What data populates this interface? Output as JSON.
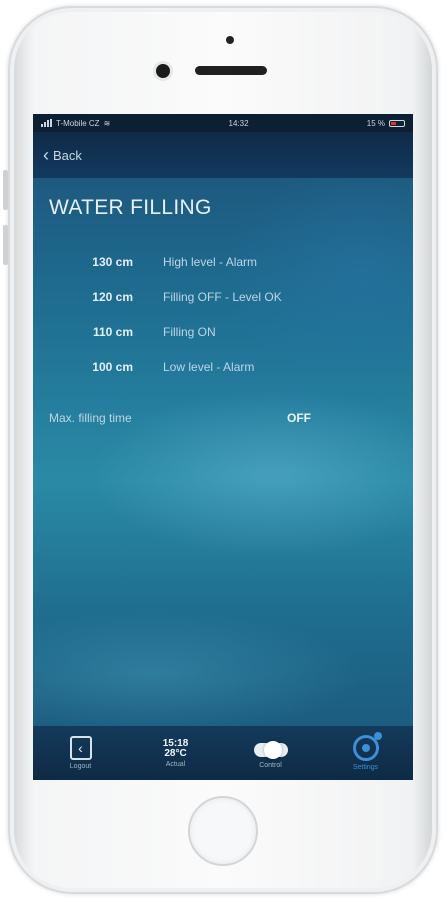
{
  "status_bar": {
    "carrier": "T-Mobile CZ",
    "time": "14:32",
    "battery": "15 %"
  },
  "nav": {
    "back_label": "Back"
  },
  "page": {
    "title": "WATER FILLING"
  },
  "levels": [
    {
      "value": "130 cm",
      "description": "High level - Alarm"
    },
    {
      "value": "120 cm",
      "description": "Filling OFF - Level OK"
    },
    {
      "value": "110 cm",
      "description": "Filling ON"
    },
    {
      "value": "100 cm",
      "description": "Low level - Alarm"
    }
  ],
  "max_filling": {
    "label": "Max. filling time",
    "value": "OFF"
  },
  "tab_bar": {
    "tabs": [
      {
        "label": "Logout",
        "icon": "chevron-left-icon"
      },
      {
        "label": "Actual",
        "time": "15:18",
        "temperature": "28°C"
      },
      {
        "label": "Control",
        "icon": "toggle-icon"
      },
      {
        "label": "Settings",
        "icon": "gear-icon",
        "active": true
      }
    ]
  },
  "colors": {
    "accent": "#3d8fd8",
    "nav_bg": "#0f2a47"
  }
}
